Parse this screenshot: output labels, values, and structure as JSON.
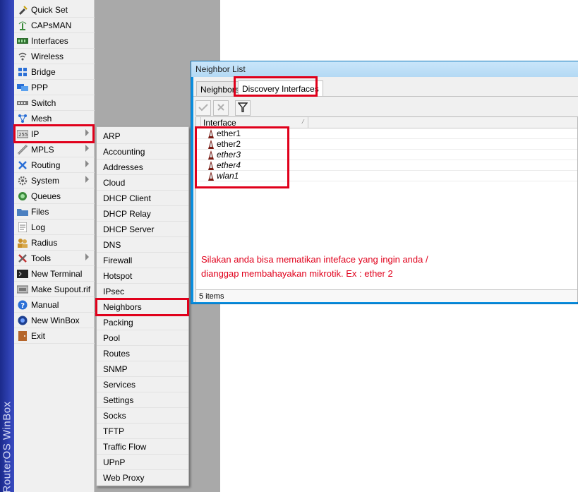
{
  "brand": "RouterOS WinBox",
  "main_menu": {
    "items": [
      {
        "label": "Quick Set",
        "icon": "quickset-icon",
        "submenu": false
      },
      {
        "label": "CAPsMAN",
        "icon": "capsman-icon",
        "submenu": false
      },
      {
        "label": "Interfaces",
        "icon": "interfaces-icon",
        "submenu": false
      },
      {
        "label": "Wireless",
        "icon": "wireless-icon",
        "submenu": false
      },
      {
        "label": "Bridge",
        "icon": "bridge-icon",
        "submenu": false
      },
      {
        "label": "PPP",
        "icon": "ppp-icon",
        "submenu": false
      },
      {
        "label": "Switch",
        "icon": "switch-icon",
        "submenu": false
      },
      {
        "label": "Mesh",
        "icon": "mesh-icon",
        "submenu": false
      },
      {
        "label": "IP",
        "icon": "ip-icon",
        "submenu": true
      },
      {
        "label": "MPLS",
        "icon": "mpls-icon",
        "submenu": true
      },
      {
        "label": "Routing",
        "icon": "routing-icon",
        "submenu": true
      },
      {
        "label": "System",
        "icon": "system-icon",
        "submenu": true
      },
      {
        "label": "Queues",
        "icon": "queues-icon",
        "submenu": false
      },
      {
        "label": "Files",
        "icon": "files-icon",
        "submenu": false
      },
      {
        "label": "Log",
        "icon": "log-icon",
        "submenu": false
      },
      {
        "label": "Radius",
        "icon": "radius-icon",
        "submenu": false
      },
      {
        "label": "Tools",
        "icon": "tools-icon",
        "submenu": true
      },
      {
        "label": "New Terminal",
        "icon": "terminal-icon",
        "submenu": false
      },
      {
        "label": "Make Supout.rif",
        "icon": "supout-icon",
        "submenu": false
      },
      {
        "label": "Manual",
        "icon": "manual-icon",
        "submenu": false
      },
      {
        "label": "New WinBox",
        "icon": "winbox-icon",
        "submenu": false
      },
      {
        "label": "Exit",
        "icon": "exit-icon",
        "submenu": false
      }
    ]
  },
  "ip_submenu": {
    "items": [
      "ARP",
      "Accounting",
      "Addresses",
      "Cloud",
      "DHCP Client",
      "DHCP Relay",
      "DHCP Server",
      "DNS",
      "Firewall",
      "Hotspot",
      "IPsec",
      "Neighbors",
      "Packing",
      "Pool",
      "Routes",
      "SNMP",
      "Services",
      "Settings",
      "Socks",
      "TFTP",
      "Traffic Flow",
      "UPnP",
      "Web Proxy"
    ],
    "highlighted": "Neighbors"
  },
  "neighbor_window": {
    "title": "Neighbor List",
    "tabs": [
      "Neighbors",
      "Discovery Interfaces"
    ],
    "active_tab": "Discovery Interfaces",
    "toolbar": {
      "enable_icon": "check-icon",
      "disable_icon": "cross-icon",
      "filter_icon": "filter-icon"
    },
    "column": "Interface",
    "rows": [
      {
        "name": "ether1",
        "disabled": false
      },
      {
        "name": "ether2",
        "disabled": false
      },
      {
        "name": "ether3",
        "disabled": true
      },
      {
        "name": "ether4",
        "disabled": true
      },
      {
        "name": "wlan1",
        "disabled": true
      }
    ],
    "note_line1": "Silakan anda bisa mematikan inteface yang ingin anda /",
    "note_line2": "dianggap membahayakan mikrotik. Ex : ether 2",
    "status": "5 items"
  },
  "colors": {
    "highlight": "#e0001b",
    "brand": "#1b2a8a",
    "note_text": "#e0001b"
  }
}
